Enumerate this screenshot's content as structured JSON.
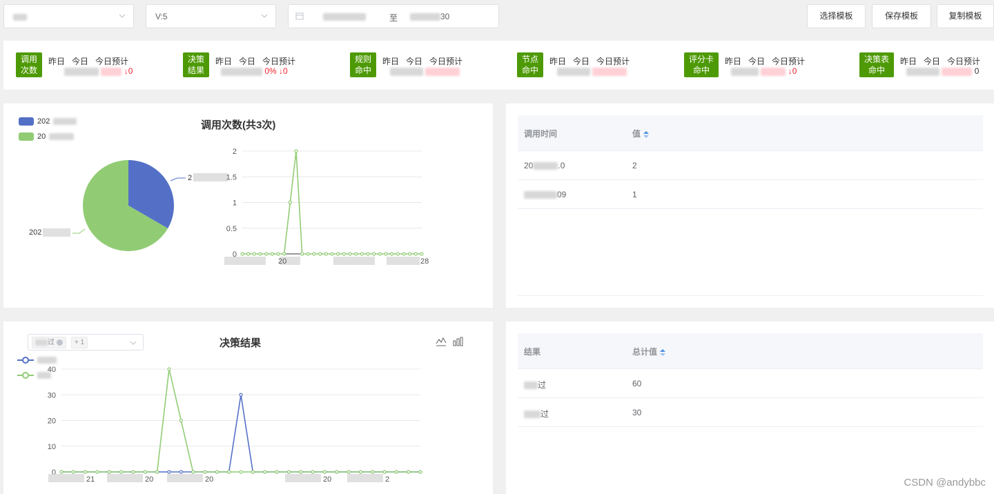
{
  "topbar": {
    "version_select": "V:5",
    "date_to": "至",
    "date_end_suffix": "30",
    "buttons": [
      "选择模板",
      "保存模板",
      "复制模板"
    ]
  },
  "stats": [
    {
      "label": [
        "调用",
        "次数"
      ],
      "cols": [
        "昨日",
        "今日",
        "今日预计"
      ],
      "suffix": "↓0"
    },
    {
      "label": [
        "决策",
        "结果"
      ],
      "cols": [
        "昨日",
        "今日",
        "今日预计"
      ],
      "suffix": "0% ↓0"
    },
    {
      "label": [
        "规则",
        "命中"
      ],
      "cols": [
        "昨日",
        "今日",
        "今日预计"
      ],
      "suffix": ""
    },
    {
      "label": [
        "节点",
        "命中"
      ],
      "cols": [
        "昨日",
        "今日",
        "今日预计"
      ],
      "suffix": ""
    },
    {
      "label": [
        "评分卡",
        "命中"
      ],
      "cols": [
        "昨日",
        "今日",
        "今日预计"
      ],
      "suffix": "↓0"
    },
    {
      "label": [
        "决策表",
        "命中"
      ],
      "cols": [
        "昨日",
        "今日",
        "今日预计"
      ],
      "suffix": "0"
    }
  ],
  "panel1": {
    "title": "调用次数(共3次)",
    "legend": [
      {
        "name": "202",
        "color": "#5470c6"
      },
      {
        "name": "20",
        "color": "#91cc75"
      }
    ],
    "pie_label_top": "2",
    "pie_label_bottom": "202"
  },
  "table1": {
    "headers": [
      "调用时间",
      "值"
    ],
    "rows": [
      [
        "20",
        "2"
      ],
      [
        "09",
        "1"
      ]
    ]
  },
  "panel2": {
    "title": "决策结果",
    "chip_more": "+ 1",
    "chip_first": "过"
  },
  "table2": {
    "headers": [
      "结果",
      "总计值"
    ],
    "rows": [
      [
        "过",
        "60"
      ],
      [
        "过",
        "30"
      ]
    ]
  },
  "chart_data": [
    {
      "type": "pie",
      "values": [
        1,
        2
      ],
      "colors": [
        "#5470c6",
        "#91cc75"
      ]
    },
    {
      "type": "line",
      "ylim": [
        0,
        2
      ],
      "yticks": [
        "0",
        "0.5",
        "1",
        "1.5",
        "2"
      ],
      "x_tick_labels": [
        "20",
        "28"
      ],
      "series": [
        {
          "color": "#91cc75",
          "values": [
            0,
            0,
            0,
            0,
            0,
            0,
            0,
            0,
            1,
            2,
            0,
            0,
            0,
            0,
            0,
            0,
            0,
            0,
            0,
            0,
            0,
            0,
            0,
            0,
            0,
            0,
            0,
            0,
            0,
            0,
            0
          ]
        }
      ]
    },
    {
      "type": "line",
      "ylim": [
        0,
        40
      ],
      "yticks": [
        "0",
        "10",
        "20",
        "30",
        "40"
      ],
      "x_tick_labels": [
        "21",
        "20",
        "20",
        "20",
        "2"
      ],
      "series": [
        {
          "color": "#5470c6",
          "values": [
            0,
            0,
            0,
            0,
            0,
            0,
            0,
            0,
            0,
            0,
            0,
            0,
            0,
            0,
            0,
            30,
            0,
            0,
            0,
            0,
            0,
            0,
            0,
            0,
            0,
            0,
            0,
            0,
            0,
            0,
            0
          ]
        },
        {
          "color": "#91cc75",
          "values": [
            0,
            0,
            0,
            0,
            0,
            0,
            0,
            0,
            0,
            40,
            20,
            0,
            0,
            0,
            0,
            0,
            0,
            0,
            0,
            0,
            0,
            0,
            0,
            0,
            0,
            0,
            0,
            0,
            0,
            0,
            0
          ]
        }
      ]
    }
  ],
  "watermark": "CSDN @andybbc"
}
